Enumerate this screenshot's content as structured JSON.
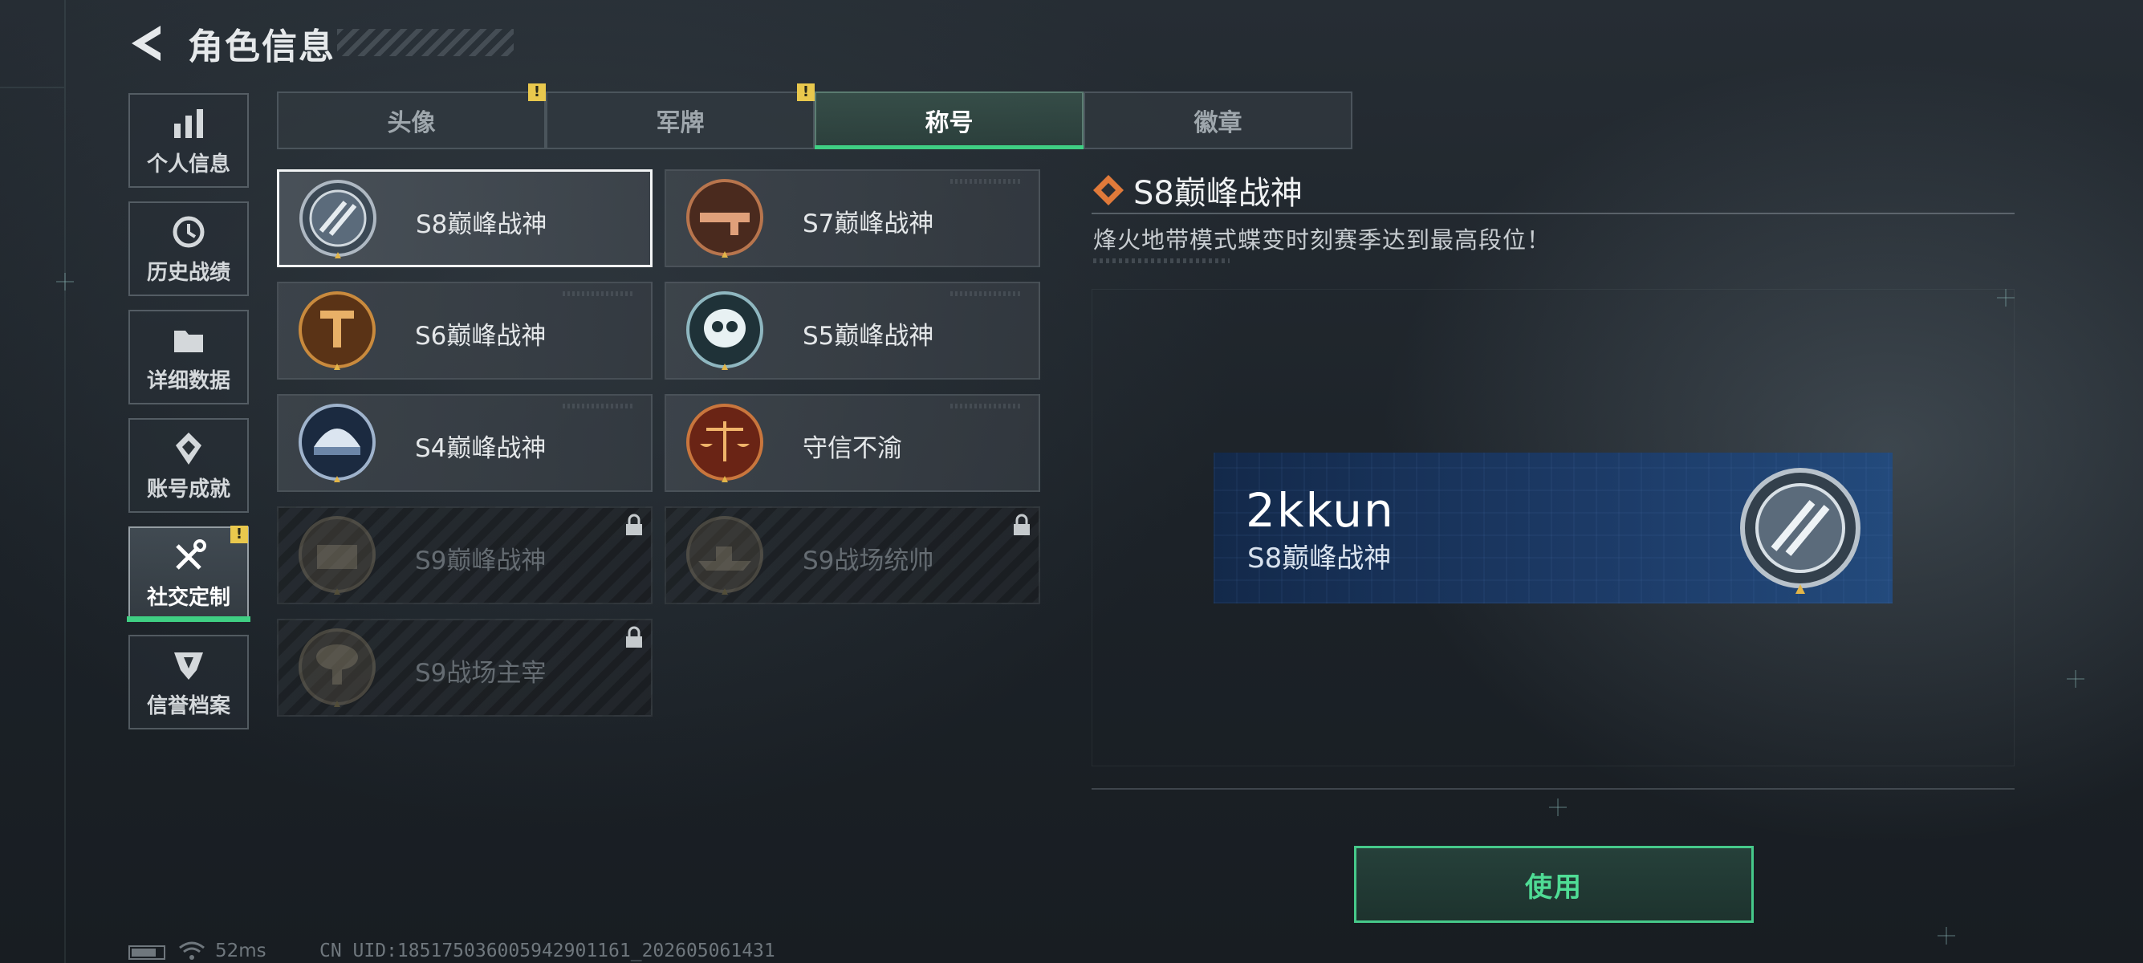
{
  "header": {
    "title": "角色信息",
    "back_icon": "back-arrow-icon"
  },
  "sidebar": {
    "items": [
      {
        "label": "个人信息",
        "icon": "bar-chart-icon"
      },
      {
        "label": "历史战绩",
        "icon": "clock-icon"
      },
      {
        "label": "详细数据",
        "icon": "folder-icon"
      },
      {
        "label": "账号成就",
        "icon": "medal-icon"
      },
      {
        "label": "社交定制",
        "icon": "tools-icon",
        "active": true,
        "badge": "!"
      },
      {
        "label": "信誉档案",
        "icon": "shield-icon"
      }
    ]
  },
  "tabs": [
    {
      "label": "头像",
      "badge": "!"
    },
    {
      "label": "军牌",
      "badge": "!"
    },
    {
      "label": "称号",
      "active": true
    },
    {
      "label": "徽章"
    }
  ],
  "titles": [
    {
      "name": "S8巅峰战神",
      "emblem": "silver-wreath-emblem-icon",
      "selected": true
    },
    {
      "name": "S7巅峰战神",
      "emblem": "rifle-emblem-icon"
    },
    {
      "name": "S6巅峰战神",
      "emblem": "bronze-t-emblem-icon"
    },
    {
      "name": "S5巅峰战神",
      "emblem": "skull-emblem-icon"
    },
    {
      "name": "S4巅峰战神",
      "emblem": "helmet-emblem-icon"
    },
    {
      "name": "守信不渝",
      "emblem": "scales-emblem-icon"
    },
    {
      "name": "S9巅峰战神",
      "emblem": "fortress-emblem-icon",
      "locked": true
    },
    {
      "name": "S9战场统帅",
      "emblem": "warship-emblem-icon",
      "locked": true
    },
    {
      "name": "S9战场主宰",
      "emblem": "mushroom-cloud-emblem-icon",
      "locked": true
    }
  ],
  "detail": {
    "title": "S8巅峰战神",
    "description": "烽火地带模式蝶变时刻赛季达到最高段位！",
    "preview": {
      "username": "2kkun",
      "title": "S8巅峰战神"
    },
    "use_button": "使用"
  },
  "status_bar": {
    "ping": "52ms",
    "uid": "CN UID:185175036005942901161_202605061431"
  },
  "colors": {
    "accent": "#3fcf83",
    "warning": "#e9c84d",
    "nameplate": "#1c3a66"
  }
}
